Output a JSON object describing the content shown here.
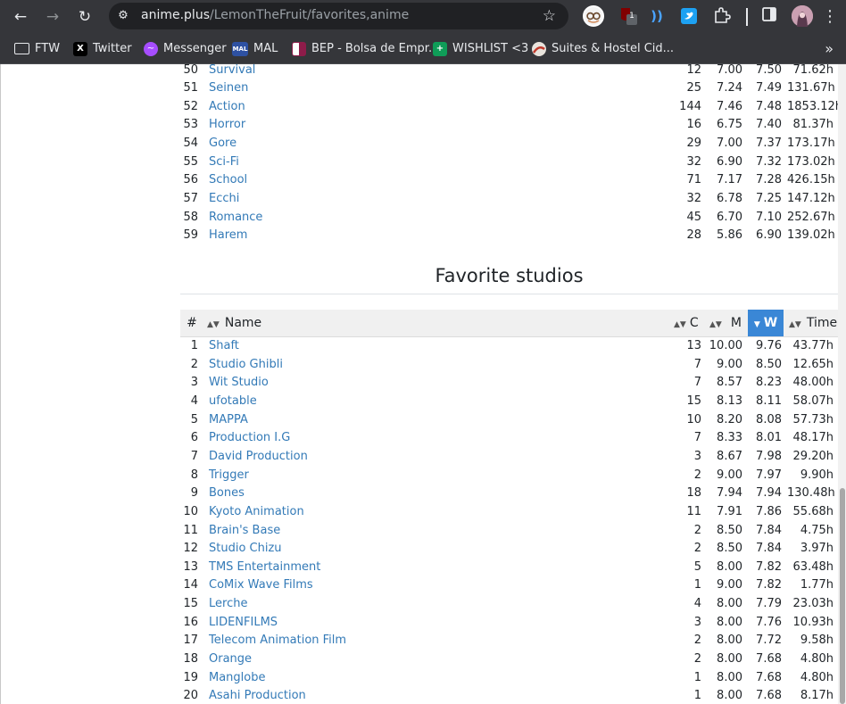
{
  "browser": {
    "url_host": "anime.plus",
    "url_path": "/LemonTheFruit/favorites,anime",
    "bookmarks": [
      {
        "label": "FTW",
        "icon": "folder-icon"
      },
      {
        "label": "Twitter",
        "icon": "x-icon"
      },
      {
        "label": "Messenger",
        "icon": "messenger-icon"
      },
      {
        "label": "MAL",
        "icon": "mal-icon"
      },
      {
        "label": "BEP - Bolsa de Empr...",
        "icon": "bep-icon"
      },
      {
        "label": "WISHLIST <3",
        "icon": "sheets-icon"
      },
      {
        "label": "Suites & Hostel Cid...",
        "icon": "hostel-icon"
      }
    ],
    "ext_badge": "1",
    "mal_icon_text": "MAL"
  },
  "genre_rows": [
    {
      "rank": "50",
      "name": "Survival",
      "count": "12",
      "mean": "7.00",
      "weighted": "7.50",
      "time": "71.62h"
    },
    {
      "rank": "51",
      "name": "Seinen",
      "count": "25",
      "mean": "7.24",
      "weighted": "7.49",
      "time": "131.67h"
    },
    {
      "rank": "52",
      "name": "Action",
      "count": "144",
      "mean": "7.46",
      "weighted": "7.48",
      "time": "1853.12h"
    },
    {
      "rank": "53",
      "name": "Horror",
      "count": "16",
      "mean": "6.75",
      "weighted": "7.40",
      "time": "81.37h"
    },
    {
      "rank": "54",
      "name": "Gore",
      "count": "29",
      "mean": "7.00",
      "weighted": "7.37",
      "time": "173.17h"
    },
    {
      "rank": "55",
      "name": "Sci-Fi",
      "count": "32",
      "mean": "6.90",
      "weighted": "7.32",
      "time": "173.02h"
    },
    {
      "rank": "56",
      "name": "School",
      "count": "71",
      "mean": "7.17",
      "weighted": "7.28",
      "time": "426.15h"
    },
    {
      "rank": "57",
      "name": "Ecchi",
      "count": "32",
      "mean": "6.78",
      "weighted": "7.25",
      "time": "147.12h"
    },
    {
      "rank": "58",
      "name": "Romance",
      "count": "45",
      "mean": "6.70",
      "weighted": "7.10",
      "time": "252.67h"
    },
    {
      "rank": "59",
      "name": "Harem",
      "count": "28",
      "mean": "5.86",
      "weighted": "6.90",
      "time": "139.02h"
    }
  ],
  "studios": {
    "title": "Favorite studios",
    "headers": {
      "rank": "#",
      "name": "Name",
      "count": "C",
      "mean": "M",
      "weighted": "W",
      "time": "Time"
    },
    "rows": [
      {
        "rank": "1",
        "name": "Shaft",
        "count": "13",
        "mean": "10.00",
        "weighted": "9.76",
        "time": "43.77h"
      },
      {
        "rank": "2",
        "name": "Studio Ghibli",
        "count": "7",
        "mean": "9.00",
        "weighted": "8.50",
        "time": "12.65h"
      },
      {
        "rank": "3",
        "name": "Wit Studio",
        "count": "7",
        "mean": "8.57",
        "weighted": "8.23",
        "time": "48.00h"
      },
      {
        "rank": "4",
        "name": "ufotable",
        "count": "15",
        "mean": "8.13",
        "weighted": "8.11",
        "time": "58.07h"
      },
      {
        "rank": "5",
        "name": "MAPPA",
        "count": "10",
        "mean": "8.20",
        "weighted": "8.08",
        "time": "57.73h"
      },
      {
        "rank": "6",
        "name": "Production I.G",
        "count": "7",
        "mean": "8.33",
        "weighted": "8.01",
        "time": "48.17h"
      },
      {
        "rank": "7",
        "name": "David Production",
        "count": "3",
        "mean": "8.67",
        "weighted": "7.98",
        "time": "29.20h"
      },
      {
        "rank": "8",
        "name": "Trigger",
        "count": "2",
        "mean": "9.00",
        "weighted": "7.97",
        "time": "9.90h"
      },
      {
        "rank": "9",
        "name": "Bones",
        "count": "18",
        "mean": "7.94",
        "weighted": "7.94",
        "time": "130.48h"
      },
      {
        "rank": "10",
        "name": "Kyoto Animation",
        "count": "11",
        "mean": "7.91",
        "weighted": "7.86",
        "time": "55.68h"
      },
      {
        "rank": "11",
        "name": "Brain's Base",
        "count": "2",
        "mean": "8.50",
        "weighted": "7.84",
        "time": "4.75h"
      },
      {
        "rank": "12",
        "name": "Studio Chizu",
        "count": "2",
        "mean": "8.50",
        "weighted": "7.84",
        "time": "3.97h"
      },
      {
        "rank": "13",
        "name": "TMS Entertainment",
        "count": "5",
        "mean": "8.00",
        "weighted": "7.82",
        "time": "63.48h"
      },
      {
        "rank": "14",
        "name": "CoMix Wave Films",
        "count": "1",
        "mean": "9.00",
        "weighted": "7.82",
        "time": "1.77h"
      },
      {
        "rank": "15",
        "name": "Lerche",
        "count": "4",
        "mean": "8.00",
        "weighted": "7.79",
        "time": "23.03h"
      },
      {
        "rank": "16",
        "name": "LIDENFILMS",
        "count": "3",
        "mean": "8.00",
        "weighted": "7.76",
        "time": "10.93h"
      },
      {
        "rank": "17",
        "name": "Telecom Animation Film",
        "count": "2",
        "mean": "8.00",
        "weighted": "7.72",
        "time": "9.58h"
      },
      {
        "rank": "18",
        "name": "Orange",
        "count": "2",
        "mean": "8.00",
        "weighted": "7.68",
        "time": "4.80h"
      },
      {
        "rank": "19",
        "name": "Manglobe",
        "count": "1",
        "mean": "8.00",
        "weighted": "7.68",
        "time": "4.80h"
      },
      {
        "rank": "20",
        "name": "Asahi Production",
        "count": "1",
        "mean": "8.00",
        "weighted": "7.68",
        "time": "8.17h"
      }
    ]
  }
}
